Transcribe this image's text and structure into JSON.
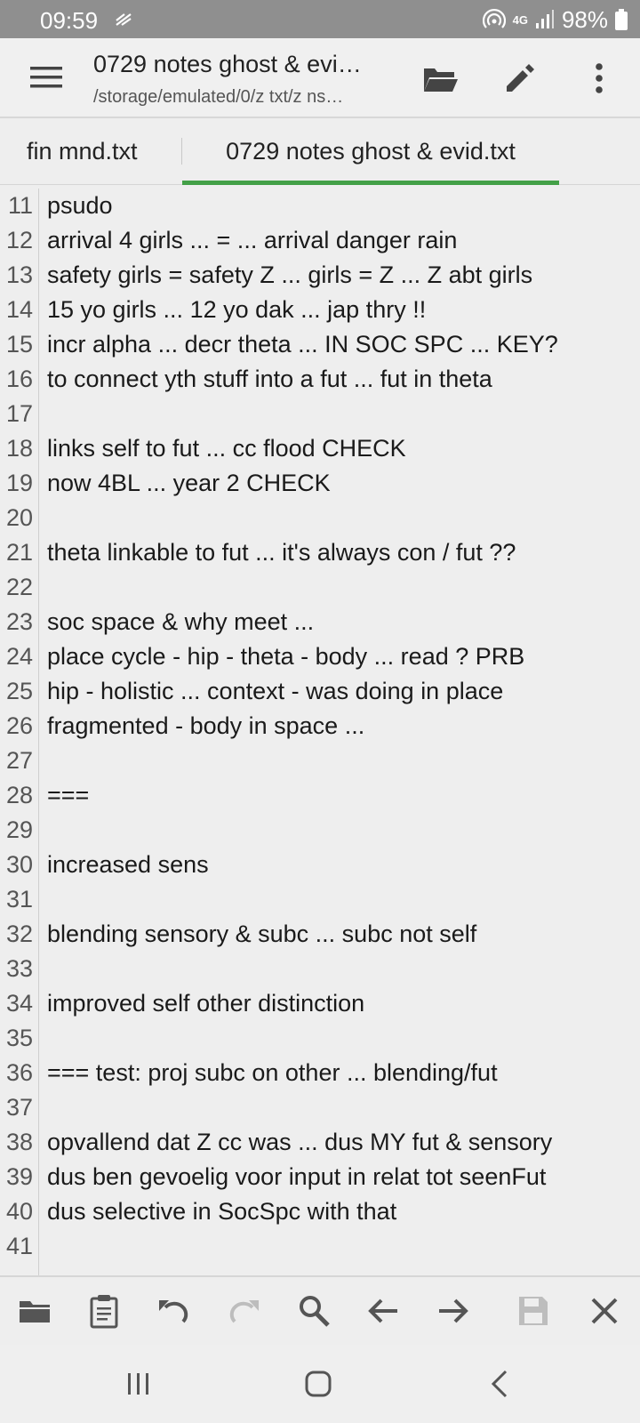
{
  "status_bar": {
    "time": "09:59",
    "network": "4G",
    "battery": "98%"
  },
  "toolbar": {
    "title": "0729 notes ghost & evi…",
    "path": "/storage/emulated/0/z txt/z ns…",
    "icons": [
      "menu-icon",
      "folder-open-icon",
      "edit-pencil-icon",
      "more-vert-icon"
    ]
  },
  "tabs": [
    {
      "label": "fin mnd.txt",
      "active": false
    },
    {
      "label": "0729 notes ghost & evid.txt",
      "active": true
    }
  ],
  "accent_color": "#43a047",
  "editor": {
    "lines": [
      {
        "num": "11",
        "text": "psudo"
      },
      {
        "num": "12",
        "text": "arrival 4 girls ... = ... arrival danger rain"
      },
      {
        "num": "13",
        "text": "safety girls = safety Z ... girls = Z ... Z abt girls"
      },
      {
        "num": "14",
        "text": "15 yo girls ... 12 yo dak ... jap thry !!"
      },
      {
        "num": "15",
        "text": "incr alpha ... decr theta ... IN SOC SPC ... KEY?"
      },
      {
        "num": "16",
        "text": "to connect yth stuff into a fut ... fut in theta"
      },
      {
        "num": "17",
        "text": ""
      },
      {
        "num": "18",
        "text": "links self to fut ... cc flood CHECK"
      },
      {
        "num": "19",
        "text": "now 4BL ... year 2 CHECK"
      },
      {
        "num": "20",
        "text": ""
      },
      {
        "num": "21",
        "text": "theta linkable to fut ... it's always con / fut ??"
      },
      {
        "num": "22",
        "text": ""
      },
      {
        "num": "23",
        "text": "soc space & why meet ..."
      },
      {
        "num": "24",
        "text": "place cycle - hip - theta - body ... read ? PRB"
      },
      {
        "num": "25",
        "text": "hip - holistic ... context - was doing in place"
      },
      {
        "num": "26",
        "text": "fragmented - body in space ..."
      },
      {
        "num": "27",
        "text": ""
      },
      {
        "num": "28",
        "text": "==="
      },
      {
        "num": "29",
        "text": ""
      },
      {
        "num": "30",
        "text": "increased sens"
      },
      {
        "num": "31",
        "text": ""
      },
      {
        "num": "32",
        "text": "blending sensory & subc ... subc not self"
      },
      {
        "num": "33",
        "text": ""
      },
      {
        "num": "34",
        "text": "improved self other distinction"
      },
      {
        "num": "35",
        "text": ""
      },
      {
        "num": "36",
        "text": "=== test: proj subc on other ... blending/fut"
      },
      {
        "num": "37",
        "text": ""
      },
      {
        "num": "38",
        "text": "opvallend dat Z cc was ... dus MY fut & sensory"
      },
      {
        "num": "39",
        "text": "dus ben gevoelig voor input in relat tot seenFut"
      },
      {
        "num": "40",
        "text": "dus selective in SocSpc with that"
      },
      {
        "num": "41",
        "text": ""
      }
    ]
  },
  "bottom_toolbar": {
    "icons": [
      "folder-icon",
      "clipboard-icon",
      "undo-icon",
      "redo-icon",
      "search-icon",
      "arrow-left-icon",
      "arrow-right-icon",
      "save-icon",
      "close-icon"
    ]
  },
  "nav_bar": {
    "icons": [
      "recents-icon",
      "home-icon",
      "back-icon"
    ]
  }
}
